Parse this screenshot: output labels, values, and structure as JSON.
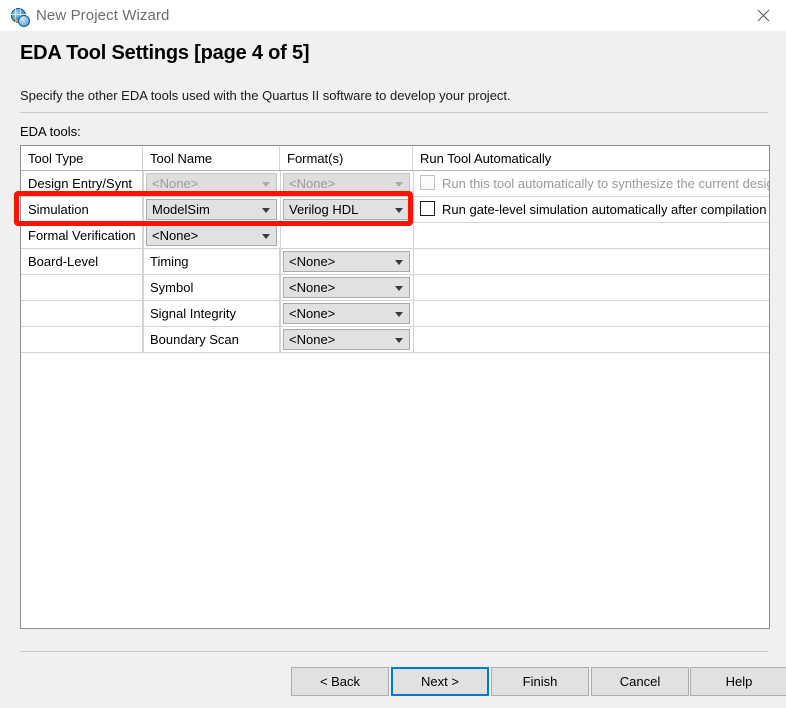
{
  "window": {
    "title": "New Project Wizard",
    "icon": "quartus-globe-magnifier-icon",
    "close_label": "✕"
  },
  "page": {
    "title": "EDA Tool Settings [page 4 of 5]",
    "description": "Specify the other EDA tools used with the Quartus II software to develop your project.",
    "section_label": "EDA tools:"
  },
  "table": {
    "headers": [
      "Tool Type",
      "Tool Name",
      "Format(s)",
      "Run Tool Automatically"
    ],
    "rows": [
      {
        "tool_type": "Design Entry/Synt",
        "tool_name": "<None>",
        "tool_name_enabled": false,
        "format": "<None>",
        "format_enabled": false,
        "auto_label": "Run this tool automatically to synthesize the current design",
        "auto_enabled": false,
        "auto_checked": false
      },
      {
        "tool_type": "Simulation",
        "tool_name": "ModelSim",
        "tool_name_enabled": true,
        "format": "Verilog HDL",
        "format_enabled": true,
        "auto_label": "Run gate-level simulation automatically after compilation",
        "auto_enabled": true,
        "auto_checked": false
      },
      {
        "tool_type": "Formal Verification",
        "tool_name": "<None>",
        "tool_name_enabled": true,
        "format": "",
        "format_enabled": false,
        "auto_label": "",
        "auto_enabled": false,
        "auto_checked": false
      },
      {
        "tool_type": "Board-Level",
        "tool_name": "Timing",
        "tool_name_is_text": true,
        "format": "<None>",
        "format_enabled": true,
        "auto_label": "",
        "auto_enabled": false,
        "auto_checked": false
      },
      {
        "tool_type": "",
        "tool_name": "Symbol",
        "tool_name_is_text": true,
        "format": "<None>",
        "format_enabled": true,
        "auto_label": "",
        "auto_enabled": false,
        "auto_checked": false
      },
      {
        "tool_type": "",
        "tool_name": "Signal Integrity",
        "tool_name_is_text": true,
        "format": "<None>",
        "format_enabled": true,
        "auto_label": "",
        "auto_enabled": false,
        "auto_checked": false
      },
      {
        "tool_type": "",
        "tool_name": "Boundary Scan",
        "tool_name_is_text": true,
        "format": "<None>",
        "format_enabled": true,
        "auto_label": "",
        "auto_enabled": false,
        "auto_checked": false
      }
    ]
  },
  "highlight": {
    "color": "#fb1405",
    "target": "simulation-row"
  },
  "buttons": {
    "back": "< Back",
    "next": "Next >",
    "finish": "Finish",
    "cancel": "Cancel",
    "help": "Help",
    "default": "next"
  }
}
